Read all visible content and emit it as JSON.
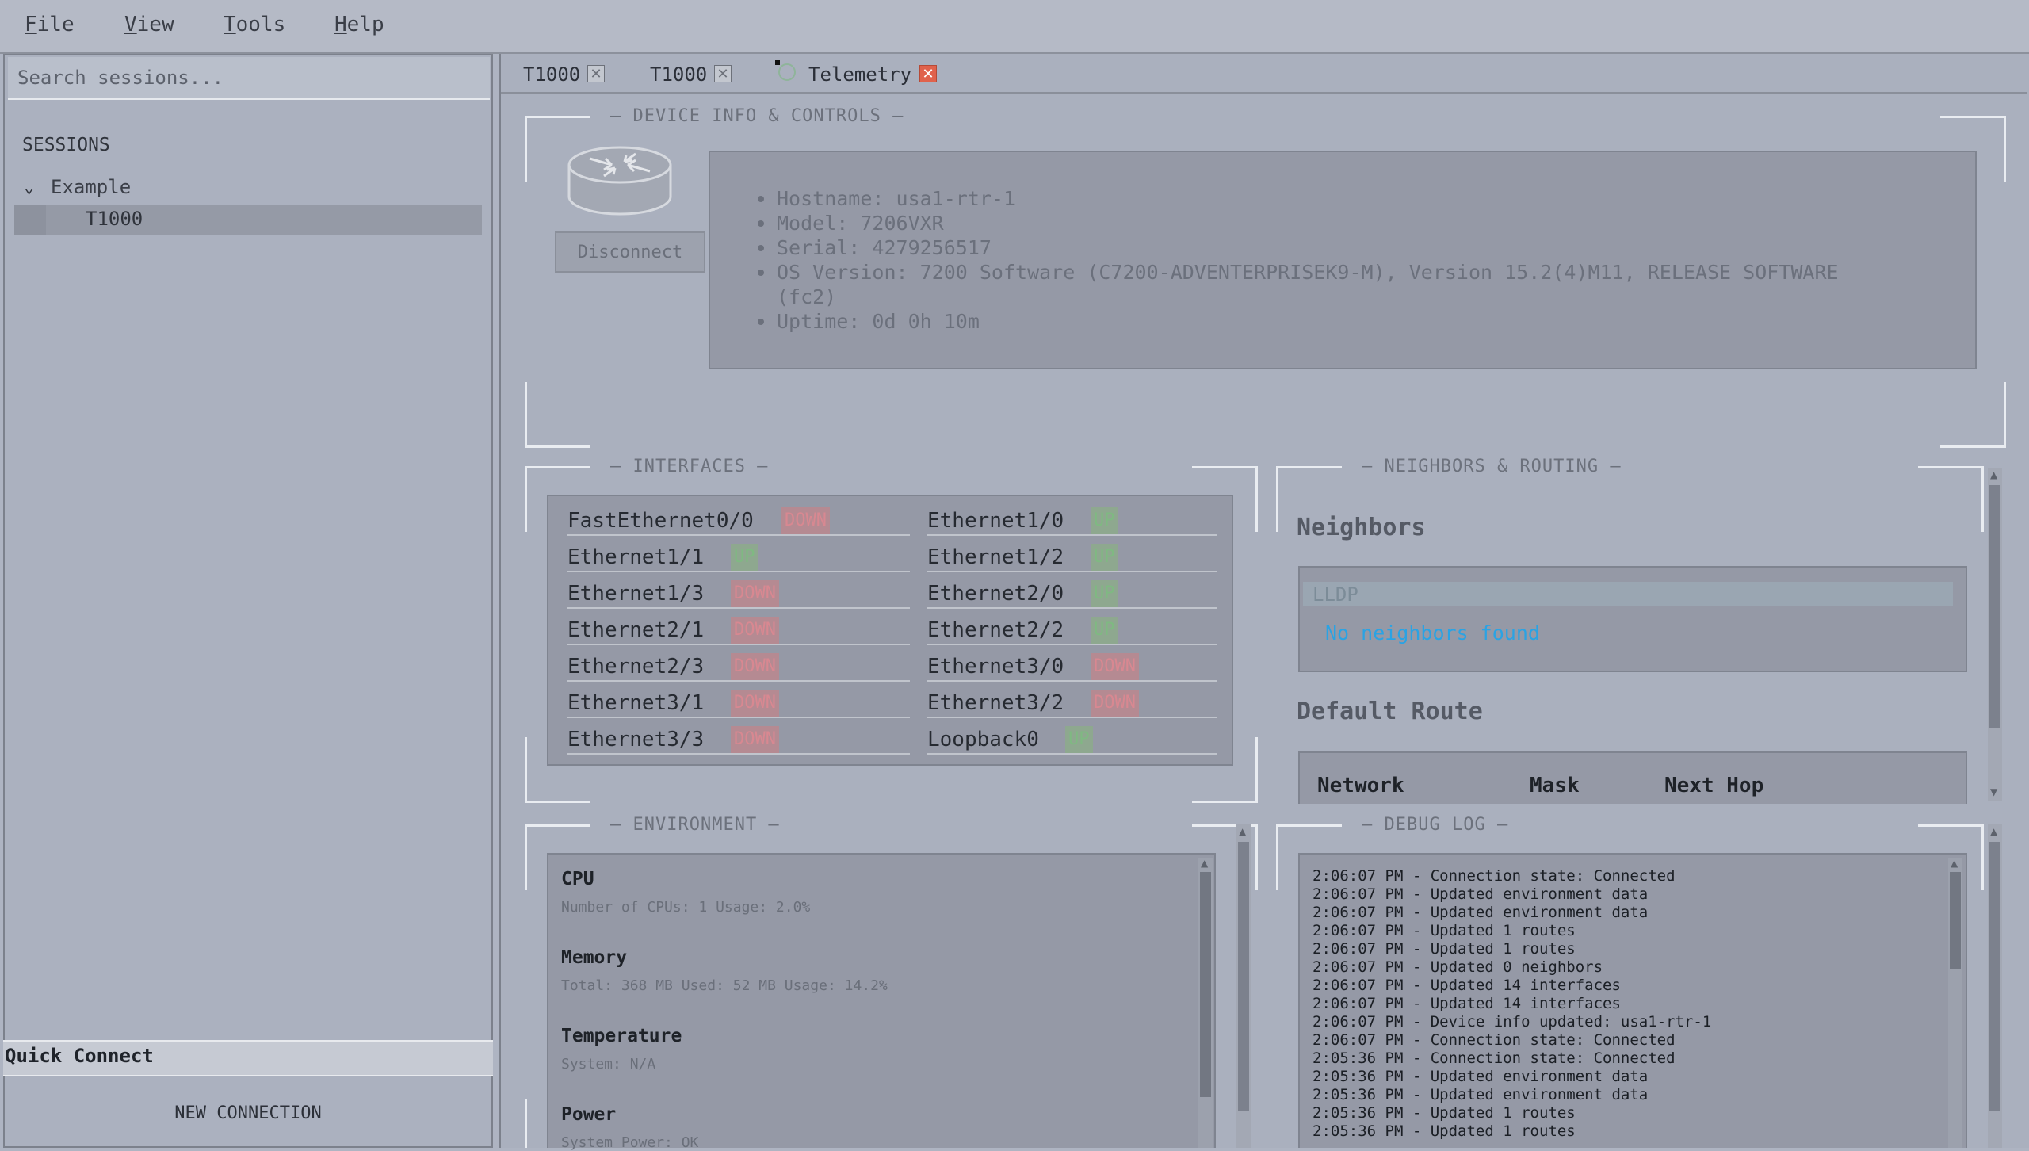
{
  "menu": {
    "file_u": "F",
    "file_rest": "ile",
    "view_u": "V",
    "view_rest": "iew",
    "tools_u": "T",
    "tools_rest": "ools",
    "help_u": "H",
    "help_rest": "elp"
  },
  "sidebar": {
    "search_placeholder": "Search sessions...",
    "sessions_heading": "SESSIONS",
    "tree": {
      "group_label": "Example",
      "item_label": "T1000"
    },
    "quick_connect_label": "Quick Connect",
    "new_connection_label": "NEW CONNECTION"
  },
  "tabs": [
    {
      "label": "T1000"
    },
    {
      "label": "T1000"
    },
    {
      "label": "Telemetry"
    }
  ],
  "icons": {
    "tab_close": "close-icon",
    "router": "router-icon",
    "chevron": "chevron-down-icon",
    "telemetry": "telemetry-status-icon"
  },
  "device": {
    "section_title": "— DEVICE INFO & CONTROLS —",
    "disconnect_label": "Disconnect",
    "lines": [
      "Hostname: usa1-rtr-1",
      "Model: 7206VXR",
      "Serial: 4279256517",
      "OS Version: 7200 Software (C7200-ADVENTERPRISEK9-M), Version 15.2(4)M11, RELEASE SOFTWARE",
      "(fc2)",
      "Uptime: 0d 0h 10m"
    ]
  },
  "interfaces": {
    "section_title": "— INTERFACES —",
    "left": [
      {
        "name": "FastEthernet0/0",
        "status": "DOWN"
      },
      {
        "name": "Ethernet1/1",
        "status": "UP"
      },
      {
        "name": "Ethernet1/3",
        "status": "DOWN"
      },
      {
        "name": "Ethernet2/1",
        "status": "DOWN"
      },
      {
        "name": "Ethernet2/3",
        "status": "DOWN"
      },
      {
        "name": "Ethernet3/1",
        "status": "DOWN"
      },
      {
        "name": "Ethernet3/3",
        "status": "DOWN"
      }
    ],
    "right": [
      {
        "name": "Ethernet1/0",
        "status": "UP"
      },
      {
        "name": "Ethernet1/2",
        "status": "UP"
      },
      {
        "name": "Ethernet2/0",
        "status": "UP"
      },
      {
        "name": "Ethernet2/2",
        "status": "UP"
      },
      {
        "name": "Ethernet3/0",
        "status": "DOWN"
      },
      {
        "name": "Ethernet3/2",
        "status": "DOWN"
      },
      {
        "name": "Loopback0",
        "status": "UP"
      }
    ]
  },
  "neighbors": {
    "section_title": "— NEIGHBORS & ROUTING —",
    "heading": "Neighbors",
    "protocol": "LLDP",
    "empty_text": "No neighbors found",
    "default_route_heading": "Default Route",
    "columns": [
      "Network",
      "Mask",
      "Next Hop"
    ]
  },
  "environment": {
    "section_title": "— ENVIRONMENT —",
    "items": [
      {
        "title": "CPU",
        "detail": "Number of CPUs: 1 Usage: 2.0%"
      },
      {
        "title": "Memory",
        "detail": "Total: 368 MB Used: 52 MB Usage: 14.2%"
      },
      {
        "title": "Temperature",
        "detail": "System: N/A"
      },
      {
        "title": "Power",
        "detail": "System Power: OK"
      }
    ]
  },
  "debug_log": {
    "section_title": "— DEBUG LOG —",
    "lines": [
      "2:06:07 PM - Connection state: Connected",
      "2:06:07 PM - Updated environment data",
      "2:06:07 PM - Updated environment data",
      "2:06:07 PM - Updated 1 routes",
      "2:06:07 PM - Updated 1 routes",
      "2:06:07 PM - Updated 0 neighbors",
      "2:06:07 PM - Updated 14 interfaces",
      "2:06:07 PM - Updated 14 interfaces",
      "2:06:07 PM - Device info updated: usa1-rtr-1",
      "2:06:07 PM - Connection state: Connected",
      "2:05:36 PM - Connection state: Connected",
      "2:05:36 PM - Updated environment data",
      "2:05:36 PM - Updated environment data",
      "2:05:36 PM - Updated 1 routes",
      "2:05:36 PM - Updated 1 routes"
    ]
  },
  "colors": {
    "status_down": "#d88891",
    "status_up": "#7fb982",
    "link_blue": "#2aa3e4",
    "close_red": "#e0624c"
  }
}
